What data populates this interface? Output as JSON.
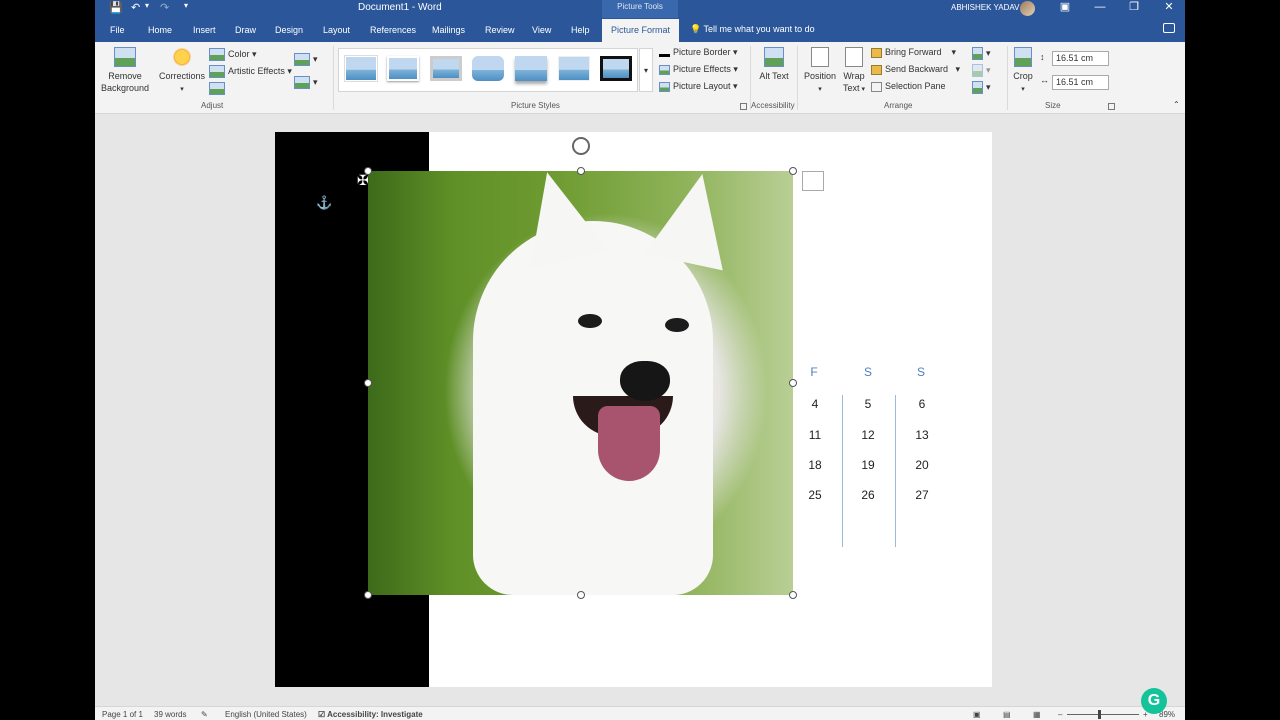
{
  "titlebar": {
    "document_title": "Document1 - Word",
    "context_tab_group": "Picture Tools",
    "user_name": "ABHISHEK YADAV"
  },
  "tabs": [
    "File",
    "Home",
    "Insert",
    "Draw",
    "Design",
    "Layout",
    "References",
    "Mailings",
    "Review",
    "View",
    "Help",
    "Picture Format"
  ],
  "active_tab": "Picture Format",
  "tell_me": "Tell me what you want to do",
  "ribbon": {
    "adjust": {
      "remove_background": "Remove Background",
      "corrections": "Corrections",
      "color": "Color",
      "artistic_effects": "Artistic Effects",
      "label": "Adjust"
    },
    "picture_styles": {
      "border": "Picture Border",
      "effects": "Picture Effects",
      "layout": "Picture Layout",
      "label": "Picture Styles"
    },
    "accessibility": {
      "alt_text": "Alt Text",
      "label": "Accessibility"
    },
    "arrange": {
      "position": "Position",
      "wrap_text": "Wrap Text",
      "bring_forward": "Bring Forward",
      "send_backward": "Send Backward",
      "selection_pane": "Selection Pane",
      "label": "Arrange"
    },
    "size": {
      "crop": "Crop",
      "height": "16.51 cm",
      "width": "16.51 cm",
      "label": "Size"
    }
  },
  "calendar": {
    "headers": [
      "F",
      "S",
      "S"
    ],
    "rows": [
      [
        "4",
        "5",
        "6"
      ],
      [
        "11",
        "12",
        "13"
      ],
      [
        "18",
        "19",
        "20"
      ],
      [
        "25",
        "26",
        "27"
      ]
    ]
  },
  "statusbar": {
    "page": "Page 1 of 1",
    "words": "39 words",
    "language": "English (United States)",
    "accessibility": "Accessibility: Investigate",
    "zoom": "89%"
  },
  "colors": {
    "title_blue": "#2b579a",
    "ribbon_bg": "#f3f3f3",
    "calendar_header": "#4f81bd"
  }
}
